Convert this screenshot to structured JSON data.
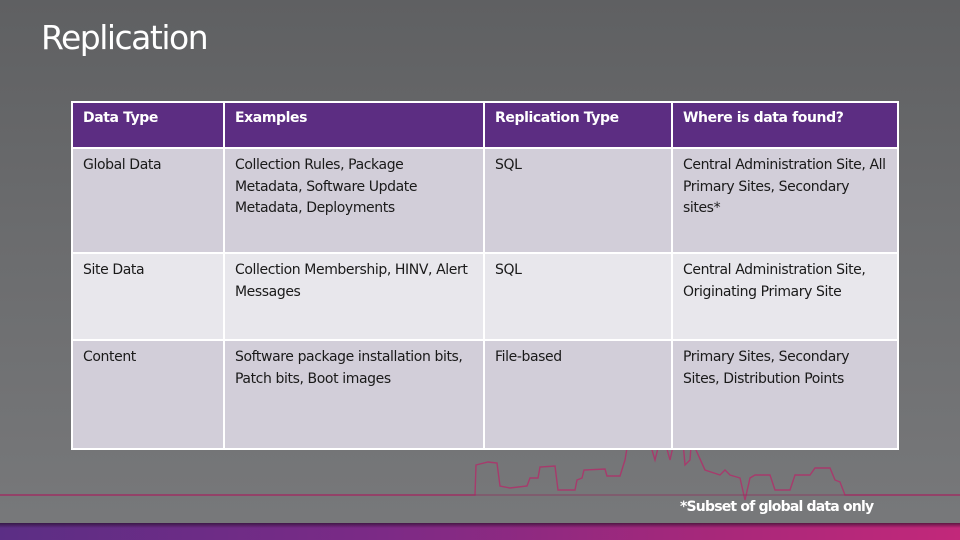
{
  "slide": {
    "title": "Replication",
    "footnote": "*Subset of global data only",
    "colors": {
      "header_bg": "#5c2d82",
      "row_odd_bg": "#d2ced9",
      "row_even_bg": "#e8e7ec",
      "skyline_stroke": "#b0306a",
      "background": "#6a6b6d"
    }
  },
  "table": {
    "headers": [
      "Data Type",
      "Examples",
      "Replication Type",
      "Where is data found?"
    ],
    "rows": [
      {
        "data_type": "Global Data",
        "examples": "Collection Rules, Package Metadata, Software Update Metadata, Deployments",
        "replication_type": "SQL",
        "location": "Central Administration Site, All Primary Sites, Secondary sites*"
      },
      {
        "data_type": "Site Data",
        "examples": "Collection Membership, HINV, Alert Messages",
        "replication_type": "SQL",
        "location": "Central Administration Site, Originating Primary Site"
      },
      {
        "data_type": "Content",
        "examples": "Software package installation bits, Patch bits, Boot images",
        "replication_type": "File-based",
        "location": "Primary Sites, Secondary Sites, Distribution Points"
      }
    ]
  }
}
